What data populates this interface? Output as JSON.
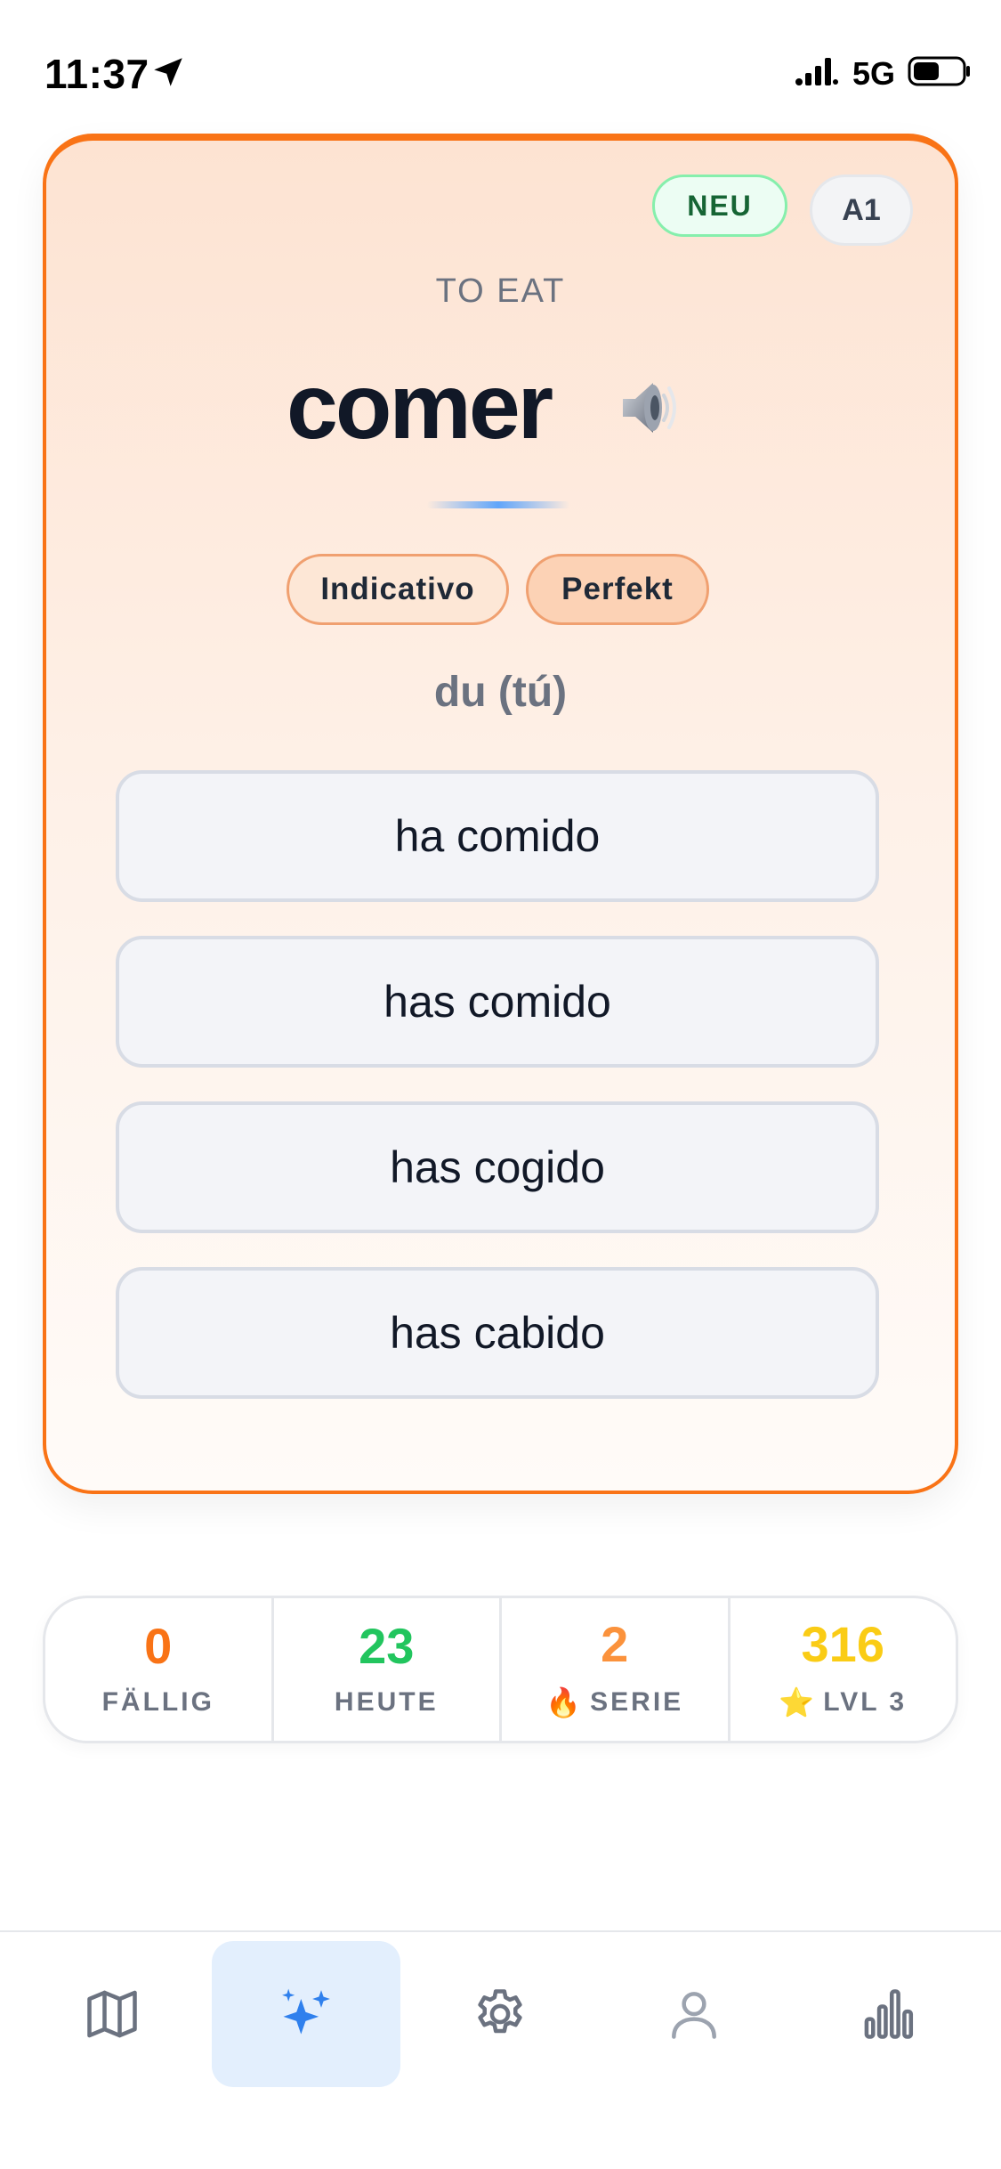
{
  "status_bar": {
    "time": "11:37",
    "network": "5G",
    "icons": [
      "location-arrow-icon",
      "signal-icon",
      "battery-icon"
    ]
  },
  "card": {
    "badge_new": "NEU",
    "badge_level": "A1",
    "translation": "TO EAT",
    "verb": "comer",
    "speaker_icon": "speaker-icon",
    "mood": "Indicativo",
    "tense": "Perfekt",
    "pronoun": "du (tú)",
    "options": [
      "ha comido",
      "has comido",
      "has cogido",
      "has cabido"
    ]
  },
  "stats": [
    {
      "value": "0",
      "label": "FÄLLIG",
      "emoji": "",
      "color": "#f97316"
    },
    {
      "value": "23",
      "label": "HEUTE",
      "emoji": "",
      "color": "#22c55e"
    },
    {
      "value": "2",
      "label": "SERIE",
      "emoji": "🔥",
      "color": "#fb923c"
    },
    {
      "value": "316",
      "label": "LVL 3",
      "emoji": "⭐",
      "color": "#facc15"
    }
  ],
  "tab_bar": {
    "items": [
      {
        "icon": "map-icon",
        "active": false
      },
      {
        "icon": "sparkles-icon",
        "active": true
      },
      {
        "icon": "gear-icon",
        "active": false
      },
      {
        "icon": "user-icon",
        "active": false
      },
      {
        "icon": "bar-chart-icon",
        "active": false
      }
    ]
  },
  "colors": {
    "accent": "#f97316",
    "active_tab": "#2f80ed",
    "active_tab_bg": "#e3effd",
    "inactive_icon": "#6b7280"
  }
}
